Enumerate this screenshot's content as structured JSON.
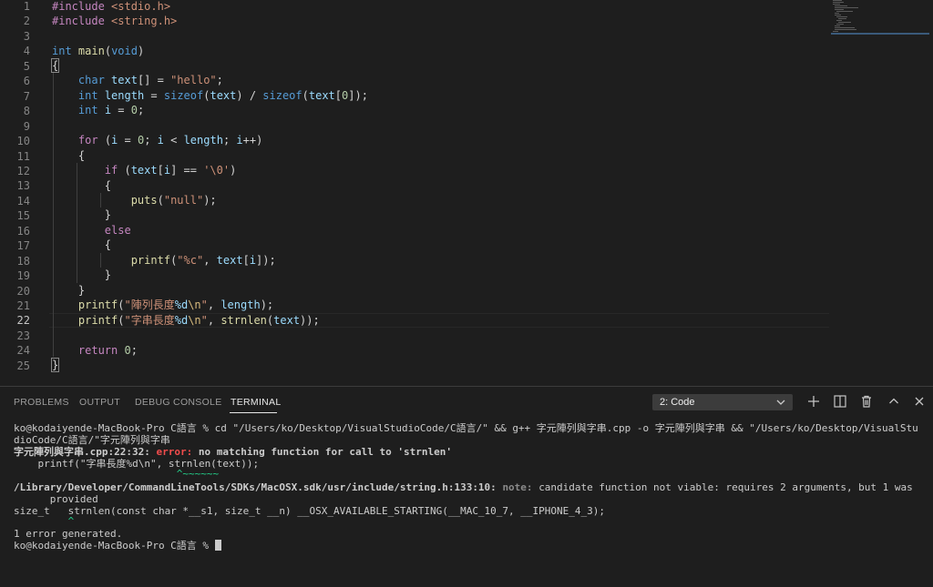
{
  "editor": {
    "line_numbers": [
      "1",
      "2",
      "3",
      "4",
      "5",
      "6",
      "7",
      "8",
      "9",
      "10",
      "11",
      "12",
      "13",
      "14",
      "15",
      "16",
      "17",
      "18",
      "19",
      "20",
      "21",
      "22",
      "23",
      "24",
      "25"
    ],
    "active_line": "22",
    "code": {
      "l1": [
        "#include",
        "<stdio.h>"
      ],
      "l2": [
        "#include",
        "<string.h>"
      ],
      "l4": [
        "int",
        "main",
        "void"
      ],
      "l6": [
        "char",
        "text",
        "\"hello\""
      ],
      "l7": [
        "int",
        "length",
        "sizeof",
        "text",
        "sizeof",
        "text",
        "0"
      ],
      "l8": [
        "int",
        "i",
        "0"
      ],
      "l10": [
        "for",
        "i",
        "0",
        "i",
        "length",
        "i"
      ],
      "l12": [
        "if",
        "text",
        "i",
        "'\\0'"
      ],
      "l14": [
        "puts",
        "\"null\""
      ],
      "l16": [
        "else"
      ],
      "l18": [
        "printf",
        "\"%c\"",
        "text",
        "i"
      ],
      "l21": [
        "printf",
        "\"陣列長度",
        "%d",
        "\\n",
        "\"",
        "length"
      ],
      "l22": [
        "printf",
        "\"字串長度",
        "%d",
        "\\n",
        "\"",
        "strnlen",
        "text"
      ],
      "l24": [
        "return",
        "0"
      ]
    }
  },
  "panel": {
    "tabs": [
      "PROBLEMS",
      "OUTPUT",
      "DEBUG CONSOLE",
      "TERMINAL"
    ],
    "active_tab": "TERMINAL",
    "terminal_select": "2: Code",
    "icons": [
      "add-icon",
      "split-icon",
      "trash-icon",
      "chevron-up-icon",
      "close-icon"
    ]
  },
  "terminal": {
    "cmd1": "ko@kodaiyende-MacBook-Pro C語言 % cd \"/Users/ko/Desktop/VisualStudioCode/C語言/\" && g++ 字元陣列與字串.cpp -o 字元陣列與字串 && \"/Users/ko/Desktop/VisualStu",
    "cmd2": "dioCode/C語言/\"字元陣列與字串",
    "err_loc": "字元陣列與字串.cpp:22:32: ",
    "err_label": "error: ",
    "err_msg": "no matching function for call to 'strnlen'",
    "err_src": "    printf(\"字串長度%d\\n\", strnlen(text));",
    "err_mark": "                           ^~~~~~~",
    "note_loc": "/Library/Developer/CommandLineTools/SDKs/MacOSX.sdk/usr/include/string.h:133:10: ",
    "note_label": "note: ",
    "note_msg": "candidate function not viable: requires 2 arguments, but 1 was",
    "note_msg2": "      provided",
    "decl": "size_t   strnlen(const char *__s1, size_t __n) __OSX_AVAILABLE_STARTING(__MAC_10_7, __IPHONE_4_3);",
    "decl_mark": "         ^",
    "summary": "1 error generated.",
    "prompt": "ko@kodaiyende-MacBook-Pro C語言 % "
  }
}
